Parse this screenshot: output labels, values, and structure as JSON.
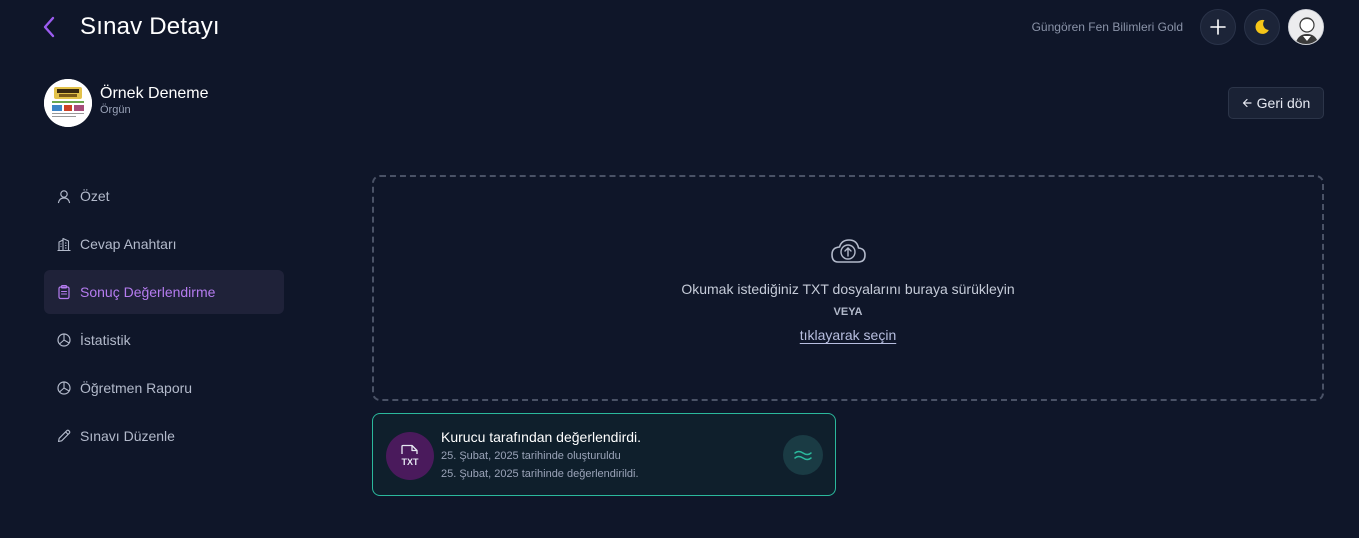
{
  "header": {
    "title": "Sınav Detayı",
    "org_name": "Güngören Fen Bilimleri Gold"
  },
  "exam": {
    "name": "Örnek Deneme",
    "type": "Örgün"
  },
  "back_button": {
    "label": "Geri dön"
  },
  "sidebar": {
    "items": [
      {
        "label": "Özet",
        "icon": "user-icon"
      },
      {
        "label": "Cevap Anahtarı",
        "icon": "building-icon"
      },
      {
        "label": "Sonuç Değerlendirme",
        "icon": "clipboard-icon",
        "active": true
      },
      {
        "label": "İstatistik",
        "icon": "pie-chart-icon"
      },
      {
        "label": "Öğretmen Raporu",
        "icon": "pie-chart-icon"
      },
      {
        "label": "Sınavı Düzenle",
        "icon": "pencil-icon"
      }
    ]
  },
  "dropzone": {
    "text": "Okumak istediğiniz TXT dosyalarını buraya sürükleyin",
    "or": "VEYA",
    "link": "tıklayarak seçin"
  },
  "file_card": {
    "badge": "TXT",
    "title": "Kurucu tarafından değerlendirdi.",
    "created": "25. Şubat, 2025 tarihinde oluşturuldu",
    "evaluated": "25. Şubat, 2025 tarihinde değerlendirildi."
  },
  "colors": {
    "background": "#0f1629",
    "accent": "#b57cf0",
    "active_bg": "#1f2239",
    "card_border": "#2bb89c",
    "badge_bg": "#4a1a5c",
    "theme_icon": "#f5c518"
  }
}
